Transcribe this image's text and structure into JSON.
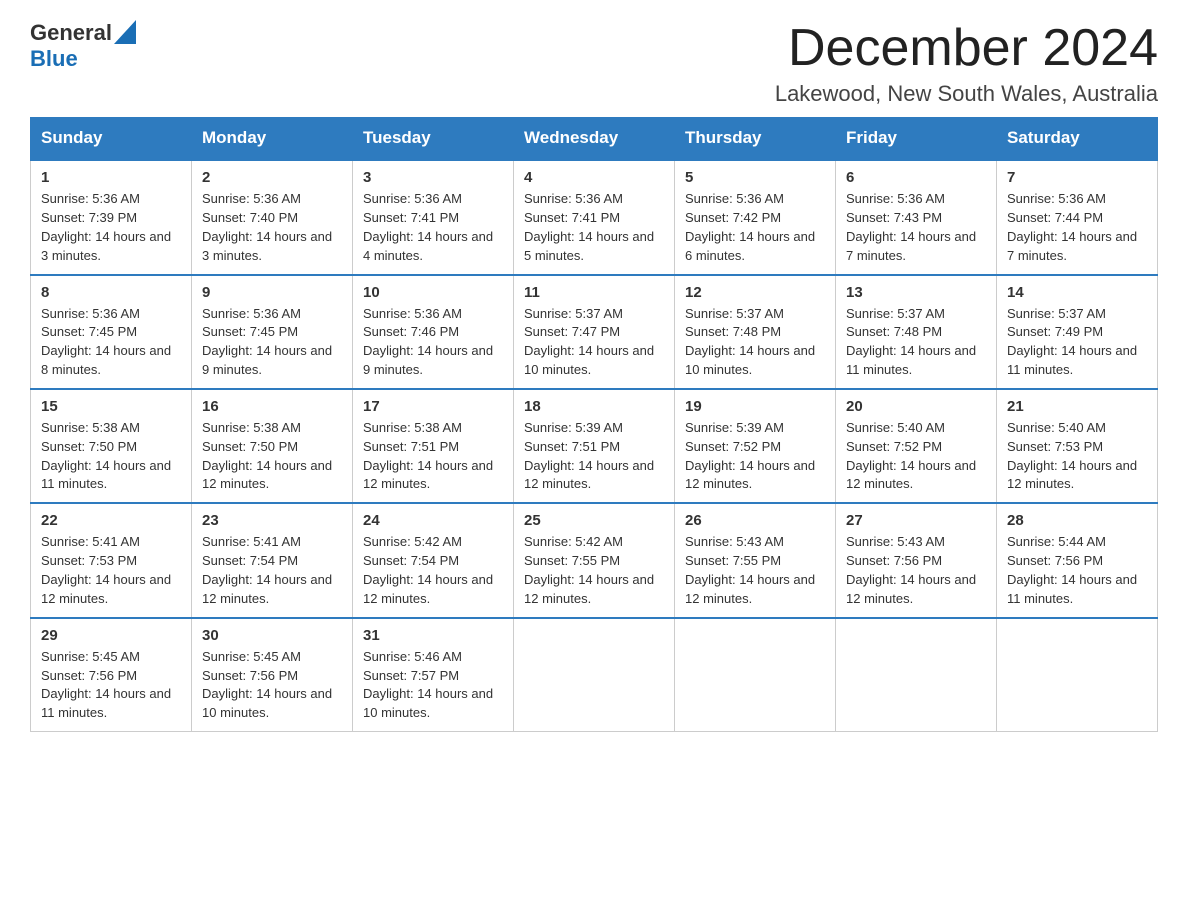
{
  "header": {
    "logo": {
      "text_general": "General",
      "text_blue": "Blue",
      "aria": "GeneralBlue logo"
    },
    "title": "December 2024",
    "subtitle": "Lakewood, New South Wales, Australia"
  },
  "calendar": {
    "days_of_week": [
      "Sunday",
      "Monday",
      "Tuesday",
      "Wednesday",
      "Thursday",
      "Friday",
      "Saturday"
    ],
    "weeks": [
      [
        {
          "day": "1",
          "sunrise": "Sunrise: 5:36 AM",
          "sunset": "Sunset: 7:39 PM",
          "daylight": "Daylight: 14 hours and 3 minutes."
        },
        {
          "day": "2",
          "sunrise": "Sunrise: 5:36 AM",
          "sunset": "Sunset: 7:40 PM",
          "daylight": "Daylight: 14 hours and 3 minutes."
        },
        {
          "day": "3",
          "sunrise": "Sunrise: 5:36 AM",
          "sunset": "Sunset: 7:41 PM",
          "daylight": "Daylight: 14 hours and 4 minutes."
        },
        {
          "day": "4",
          "sunrise": "Sunrise: 5:36 AM",
          "sunset": "Sunset: 7:41 PM",
          "daylight": "Daylight: 14 hours and 5 minutes."
        },
        {
          "day": "5",
          "sunrise": "Sunrise: 5:36 AM",
          "sunset": "Sunset: 7:42 PM",
          "daylight": "Daylight: 14 hours and 6 minutes."
        },
        {
          "day": "6",
          "sunrise": "Sunrise: 5:36 AM",
          "sunset": "Sunset: 7:43 PM",
          "daylight": "Daylight: 14 hours and 7 minutes."
        },
        {
          "day": "7",
          "sunrise": "Sunrise: 5:36 AM",
          "sunset": "Sunset: 7:44 PM",
          "daylight": "Daylight: 14 hours and 7 minutes."
        }
      ],
      [
        {
          "day": "8",
          "sunrise": "Sunrise: 5:36 AM",
          "sunset": "Sunset: 7:45 PM",
          "daylight": "Daylight: 14 hours and 8 minutes."
        },
        {
          "day": "9",
          "sunrise": "Sunrise: 5:36 AM",
          "sunset": "Sunset: 7:45 PM",
          "daylight": "Daylight: 14 hours and 9 minutes."
        },
        {
          "day": "10",
          "sunrise": "Sunrise: 5:36 AM",
          "sunset": "Sunset: 7:46 PM",
          "daylight": "Daylight: 14 hours and 9 minutes."
        },
        {
          "day": "11",
          "sunrise": "Sunrise: 5:37 AM",
          "sunset": "Sunset: 7:47 PM",
          "daylight": "Daylight: 14 hours and 10 minutes."
        },
        {
          "day": "12",
          "sunrise": "Sunrise: 5:37 AM",
          "sunset": "Sunset: 7:48 PM",
          "daylight": "Daylight: 14 hours and 10 minutes."
        },
        {
          "day": "13",
          "sunrise": "Sunrise: 5:37 AM",
          "sunset": "Sunset: 7:48 PM",
          "daylight": "Daylight: 14 hours and 11 minutes."
        },
        {
          "day": "14",
          "sunrise": "Sunrise: 5:37 AM",
          "sunset": "Sunset: 7:49 PM",
          "daylight": "Daylight: 14 hours and 11 minutes."
        }
      ],
      [
        {
          "day": "15",
          "sunrise": "Sunrise: 5:38 AM",
          "sunset": "Sunset: 7:50 PM",
          "daylight": "Daylight: 14 hours and 11 minutes."
        },
        {
          "day": "16",
          "sunrise": "Sunrise: 5:38 AM",
          "sunset": "Sunset: 7:50 PM",
          "daylight": "Daylight: 14 hours and 12 minutes."
        },
        {
          "day": "17",
          "sunrise": "Sunrise: 5:38 AM",
          "sunset": "Sunset: 7:51 PM",
          "daylight": "Daylight: 14 hours and 12 minutes."
        },
        {
          "day": "18",
          "sunrise": "Sunrise: 5:39 AM",
          "sunset": "Sunset: 7:51 PM",
          "daylight": "Daylight: 14 hours and 12 minutes."
        },
        {
          "day": "19",
          "sunrise": "Sunrise: 5:39 AM",
          "sunset": "Sunset: 7:52 PM",
          "daylight": "Daylight: 14 hours and 12 minutes."
        },
        {
          "day": "20",
          "sunrise": "Sunrise: 5:40 AM",
          "sunset": "Sunset: 7:52 PM",
          "daylight": "Daylight: 14 hours and 12 minutes."
        },
        {
          "day": "21",
          "sunrise": "Sunrise: 5:40 AM",
          "sunset": "Sunset: 7:53 PM",
          "daylight": "Daylight: 14 hours and 12 minutes."
        }
      ],
      [
        {
          "day": "22",
          "sunrise": "Sunrise: 5:41 AM",
          "sunset": "Sunset: 7:53 PM",
          "daylight": "Daylight: 14 hours and 12 minutes."
        },
        {
          "day": "23",
          "sunrise": "Sunrise: 5:41 AM",
          "sunset": "Sunset: 7:54 PM",
          "daylight": "Daylight: 14 hours and 12 minutes."
        },
        {
          "day": "24",
          "sunrise": "Sunrise: 5:42 AM",
          "sunset": "Sunset: 7:54 PM",
          "daylight": "Daylight: 14 hours and 12 minutes."
        },
        {
          "day": "25",
          "sunrise": "Sunrise: 5:42 AM",
          "sunset": "Sunset: 7:55 PM",
          "daylight": "Daylight: 14 hours and 12 minutes."
        },
        {
          "day": "26",
          "sunrise": "Sunrise: 5:43 AM",
          "sunset": "Sunset: 7:55 PM",
          "daylight": "Daylight: 14 hours and 12 minutes."
        },
        {
          "day": "27",
          "sunrise": "Sunrise: 5:43 AM",
          "sunset": "Sunset: 7:56 PM",
          "daylight": "Daylight: 14 hours and 12 minutes."
        },
        {
          "day": "28",
          "sunrise": "Sunrise: 5:44 AM",
          "sunset": "Sunset: 7:56 PM",
          "daylight": "Daylight: 14 hours and 11 minutes."
        }
      ],
      [
        {
          "day": "29",
          "sunrise": "Sunrise: 5:45 AM",
          "sunset": "Sunset: 7:56 PM",
          "daylight": "Daylight: 14 hours and 11 minutes."
        },
        {
          "day": "30",
          "sunrise": "Sunrise: 5:45 AM",
          "sunset": "Sunset: 7:56 PM",
          "daylight": "Daylight: 14 hours and 10 minutes."
        },
        {
          "day": "31",
          "sunrise": "Sunrise: 5:46 AM",
          "sunset": "Sunset: 7:57 PM",
          "daylight": "Daylight: 14 hours and 10 minutes."
        },
        null,
        null,
        null,
        null
      ]
    ]
  }
}
